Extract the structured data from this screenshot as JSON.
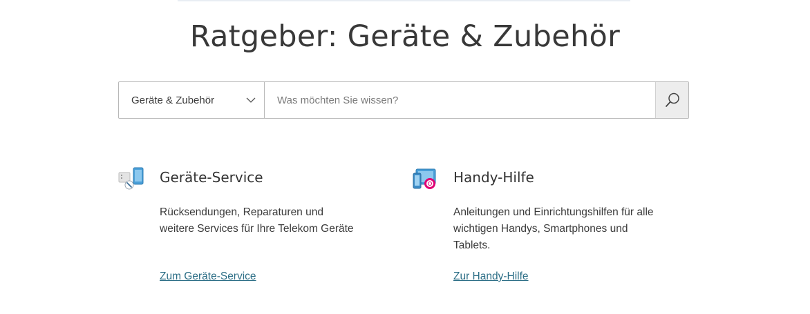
{
  "header": {
    "title": "Ratgeber: Geräte & Zubehör"
  },
  "search": {
    "category_selected": "Geräte & Zubehör",
    "placeholder": "Was möchten Sie wissen?"
  },
  "cards": [
    {
      "icon": "devices-service-icon",
      "title": "Geräte-Service",
      "text": "Rücksendungen, Reparaturen und weitere Services für Ihre Telekom Geräte",
      "link": "Zum Geräte-Service"
    },
    {
      "icon": "phone-help-icon",
      "title": "Handy-Hilfe",
      "text": "Anleitungen und Einrichtungshilfen für alle wichtigen Handys, Smartphones und Tablets.",
      "link": "Zur Handy-Hilfe"
    }
  ],
  "colors": {
    "link": "#2c6e86",
    "magenta": "#e20074",
    "device_blue": "#4a9fd8"
  }
}
